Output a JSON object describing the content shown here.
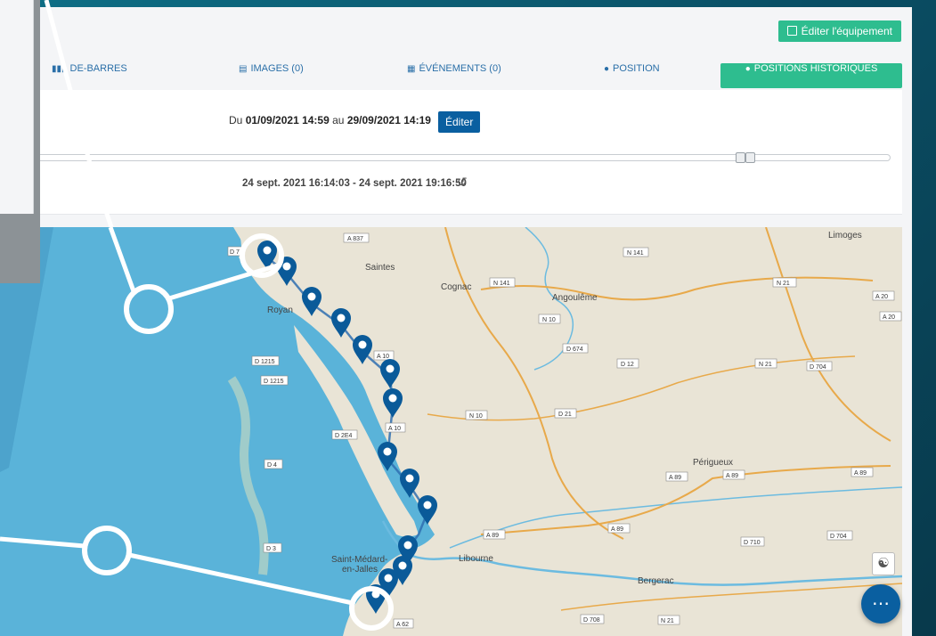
{
  "header": {
    "edit_equipment": "Éditer l'équipement"
  },
  "tabs": [
    {
      "label": "DE-BARRES",
      "icon": "barcode-icon"
    },
    {
      "label": "IMAGES (0)",
      "icon": "images-icon"
    },
    {
      "label": "ÉVÉNEMENTS (0)",
      "icon": "calendar-icon"
    },
    {
      "label": "POSITION",
      "icon": "map-marker-icon"
    },
    {
      "label": "POSITIONS HISTORIQUES",
      "icon": "map-marker-icon",
      "active": true
    }
  ],
  "range": {
    "prefix": "Du",
    "from": "01/09/2021 14:59",
    "mid": "au",
    "to": "29/09/2021 14:19",
    "edit_label": "Éditer"
  },
  "time_window": "24 sept. 2021 16:14:03 - 24 sept. 2021 19:16:50",
  "map": {
    "cities": [
      "Limoges",
      "Saintes",
      "Cognac",
      "Angoulême",
      "Royan",
      "Périgueux",
      "Libourne",
      "Saint-Médard-",
      "en-Jalles",
      "Bergerac"
    ],
    "roads": [
      "A 837",
      "D 7",
      "N 141",
      "N 141",
      "N 21",
      "A 20",
      "A 20",
      "N 10",
      "D 674",
      "D 1215",
      "A 10",
      "D 1215",
      "D 12",
      "N 21",
      "D 704",
      "N 10",
      "D 21",
      "A 10",
      "D 2E4",
      "D 4",
      "A 89",
      "A 89",
      "A 89",
      "D 3",
      "A 89",
      "A 89",
      "D 710",
      "D 704",
      "D 708",
      "N 21",
      "A 62"
    ]
  },
  "colors": {
    "accent": "#2ebd8f",
    "primary": "#0a5fa0",
    "link": "#2a6fa8",
    "water": "#5ab3d9",
    "marker": "#0a5a99"
  }
}
